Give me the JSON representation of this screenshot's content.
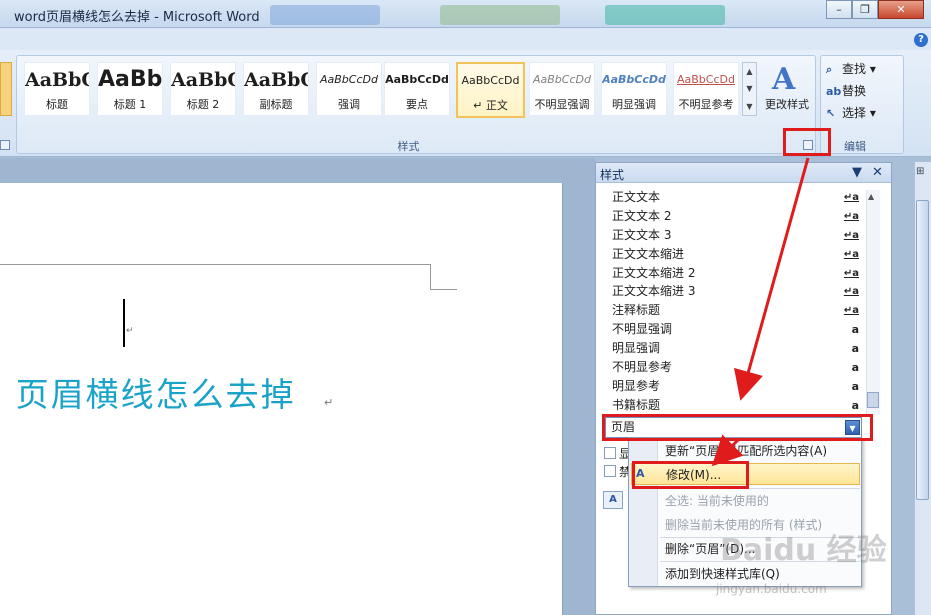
{
  "window": {
    "title": "word页眉横线怎么去掉 - Microsoft Word",
    "buttons": {
      "minimize": "–",
      "restore": "❐",
      "close": "✕"
    },
    "help": "?"
  },
  "ribbon": {
    "gallery": [
      {
        "sample": "AaBbC",
        "label": "标题"
      },
      {
        "sample": "AaBb",
        "label": "标题 1"
      },
      {
        "sample": "AaBbC",
        "label": "标题 2"
      },
      {
        "sample": "AaBbC",
        "label": "副标题"
      },
      {
        "sample": "AaBbCcDd",
        "label": "强调"
      },
      {
        "sample": "AaBbCcDd",
        "label": "要点"
      },
      {
        "sample": "AaBbCcDd",
        "label": "↵ 正文"
      },
      {
        "sample": "AaBbCcDd",
        "label": "不明显强调"
      },
      {
        "sample": "AaBbCcDd",
        "label": "明显强调"
      },
      {
        "sample": "AaBbCcDd",
        "label": "不明显参考"
      }
    ],
    "change_styles_label": "更改样式",
    "styles_group_label": "样式",
    "editing_group_label": "编辑",
    "edit_items": [
      {
        "icon": "binoculars-icon",
        "label": "查找"
      },
      {
        "icon": "replace-icon",
        "label": "替换"
      },
      {
        "icon": "select-icon",
        "label": "选择"
      }
    ]
  },
  "document": {
    "title_text": "页眉横线怎么去掉",
    "para_mark": "↵"
  },
  "styles_pane": {
    "title": "样式",
    "items": [
      {
        "name": "正文文本",
        "mark": "↵a"
      },
      {
        "name": "正文文本 2",
        "mark": "↵a"
      },
      {
        "name": "正文文本 3",
        "mark": "↵a"
      },
      {
        "name": "正文文本缩进",
        "mark": "↵a"
      },
      {
        "name": "正文文本缩进 2",
        "mark": "↵a"
      },
      {
        "name": "正文文本缩进 3",
        "mark": "↵a"
      },
      {
        "name": "注释标题",
        "mark": "↵a"
      },
      {
        "name": "不明显强调",
        "mark": "a"
      },
      {
        "name": "明显强调",
        "mark": "a"
      },
      {
        "name": "不明显参考",
        "mark": "a"
      },
      {
        "name": "明显参考",
        "mark": "a"
      },
      {
        "name": "书籍标题",
        "mark": "a"
      }
    ],
    "selected": "页眉",
    "checkbox1": "显",
    "checkbox2": "禁"
  },
  "context_menu": {
    "items": [
      {
        "label": "更新“页眉”以匹配所选内容(A)",
        "disabled": false
      },
      {
        "label": "修改(M)...",
        "disabled": false,
        "highlighted": true
      },
      {
        "label": "全选: 当前未使用的",
        "disabled": true
      },
      {
        "label": "删除当前未使用的所有 (样式)",
        "disabled": true
      },
      {
        "label": "删除“页眉”(D)...",
        "disabled": false
      },
      {
        "label": "添加到快速样式库(Q)",
        "disabled": false
      }
    ]
  },
  "watermark": {
    "main": "Baidu 经验",
    "sub": "jingyan.baidu.com"
  },
  "colors": {
    "annotation_red": "#e01b1b",
    "title_blue": "#1aa3c9"
  }
}
